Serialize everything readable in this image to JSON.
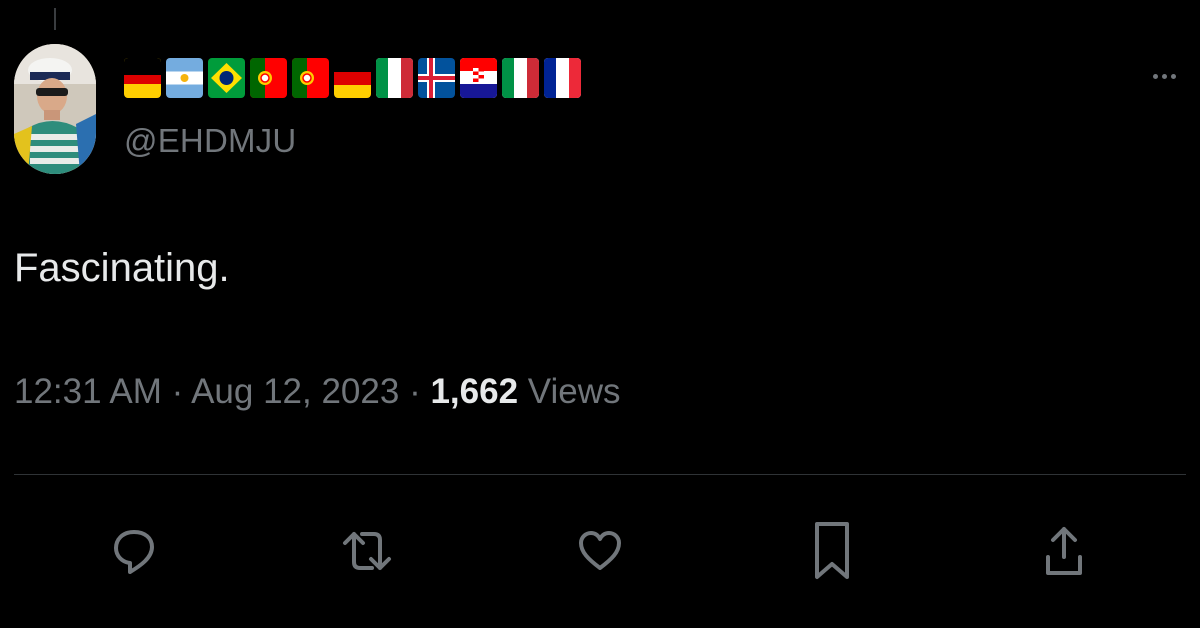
{
  "tweet": {
    "display_name_flags": [
      "germany",
      "argentina",
      "brazil",
      "portugal",
      "portugal",
      "germany",
      "italy",
      "iceland",
      "croatia",
      "italy",
      "france"
    ],
    "handle": "@EHDMJU",
    "text": "Fascinating.",
    "time": "12:31 AM",
    "date": "Aug 12, 2023",
    "separator": "·",
    "views_count": "1,662",
    "views_label": "Views"
  },
  "actions": [
    {
      "name": "reply",
      "icon": "speech-bubble-icon"
    },
    {
      "name": "retweet",
      "icon": "retweet-arrows-icon"
    },
    {
      "name": "like",
      "icon": "heart-icon"
    },
    {
      "name": "bookmark",
      "icon": "bookmark-icon"
    },
    {
      "name": "share",
      "icon": "share-upload-icon"
    }
  ],
  "colors": {
    "background": "#000000",
    "primary_text": "#e7e9ea",
    "secondary_text": "#71767b",
    "divider": "#2f3336"
  }
}
